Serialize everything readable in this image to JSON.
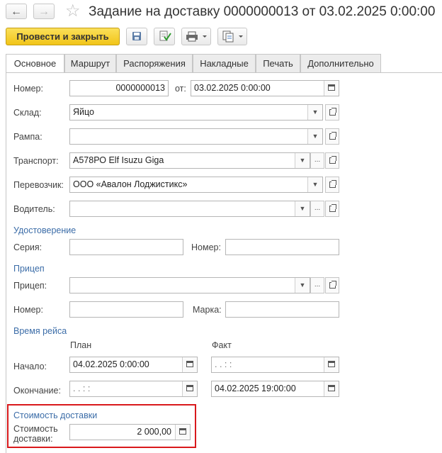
{
  "window": {
    "title": "Задание на доставку 0000000013 от 03.02.2025 0:00:00",
    "back_icon": "arrow-left-icon",
    "forward_icon": "arrow-right-icon",
    "favorite_icon": "star-icon"
  },
  "toolbar": {
    "post_close_label": "Провести и закрыть",
    "icons": [
      "save-icon",
      "post-icon",
      "print-icon",
      "create-based-icon"
    ]
  },
  "tabs": [
    "Основное",
    "Маршрут",
    "Распоряжения",
    "Накладные",
    "Печать",
    "Дополнительно"
  ],
  "form": {
    "number_label": "Номер:",
    "number_value": "0000000013",
    "date_label": "от:",
    "date_value": "03.02.2025  0:00:00",
    "warehouse_label": "Склад:",
    "warehouse_value": "Яйцо",
    "ramp_label": "Рампа:",
    "ramp_value": "",
    "transport_label": "Транспорт:",
    "transport_value": "А578РО Elf Isuzu Giga",
    "carrier_label": "Перевозчик:",
    "carrier_value": "ООО «Авалон Лоджистикс»",
    "driver_label": "Водитель:",
    "driver_value": "",
    "license_section": "Удостоверение",
    "series_label": "Серия:",
    "series_value": "",
    "license_number_label": "Номер:",
    "license_number_value": "",
    "trailer_section": "Прицеп",
    "trailer_label": "Прицеп:",
    "trailer_value": "",
    "trailer_number_label": "Номер:",
    "trailer_number_value": "",
    "trailer_brand_label": "Марка:",
    "trailer_brand_value": "",
    "trip_section": "Время рейса",
    "plan_header": "План",
    "fact_header": "Факт",
    "start_label": "Начало:",
    "start_plan": "04.02.2025  0:00:00",
    "start_fact": "  .   .          :   :",
    "end_label": "Окончание:",
    "end_plan": "  .   .          :   :",
    "end_fact": "04.02.2025 19:00:00",
    "cost_section": "Стоимость доставки",
    "cost_label_line1": "Стоимость",
    "cost_label_line2": "доставки:",
    "cost_value": "2 000,00"
  },
  "colors": {
    "primary_button": "#f4c82a",
    "section_heading": "#3c6da8",
    "highlight_frame": "#d9191c"
  }
}
